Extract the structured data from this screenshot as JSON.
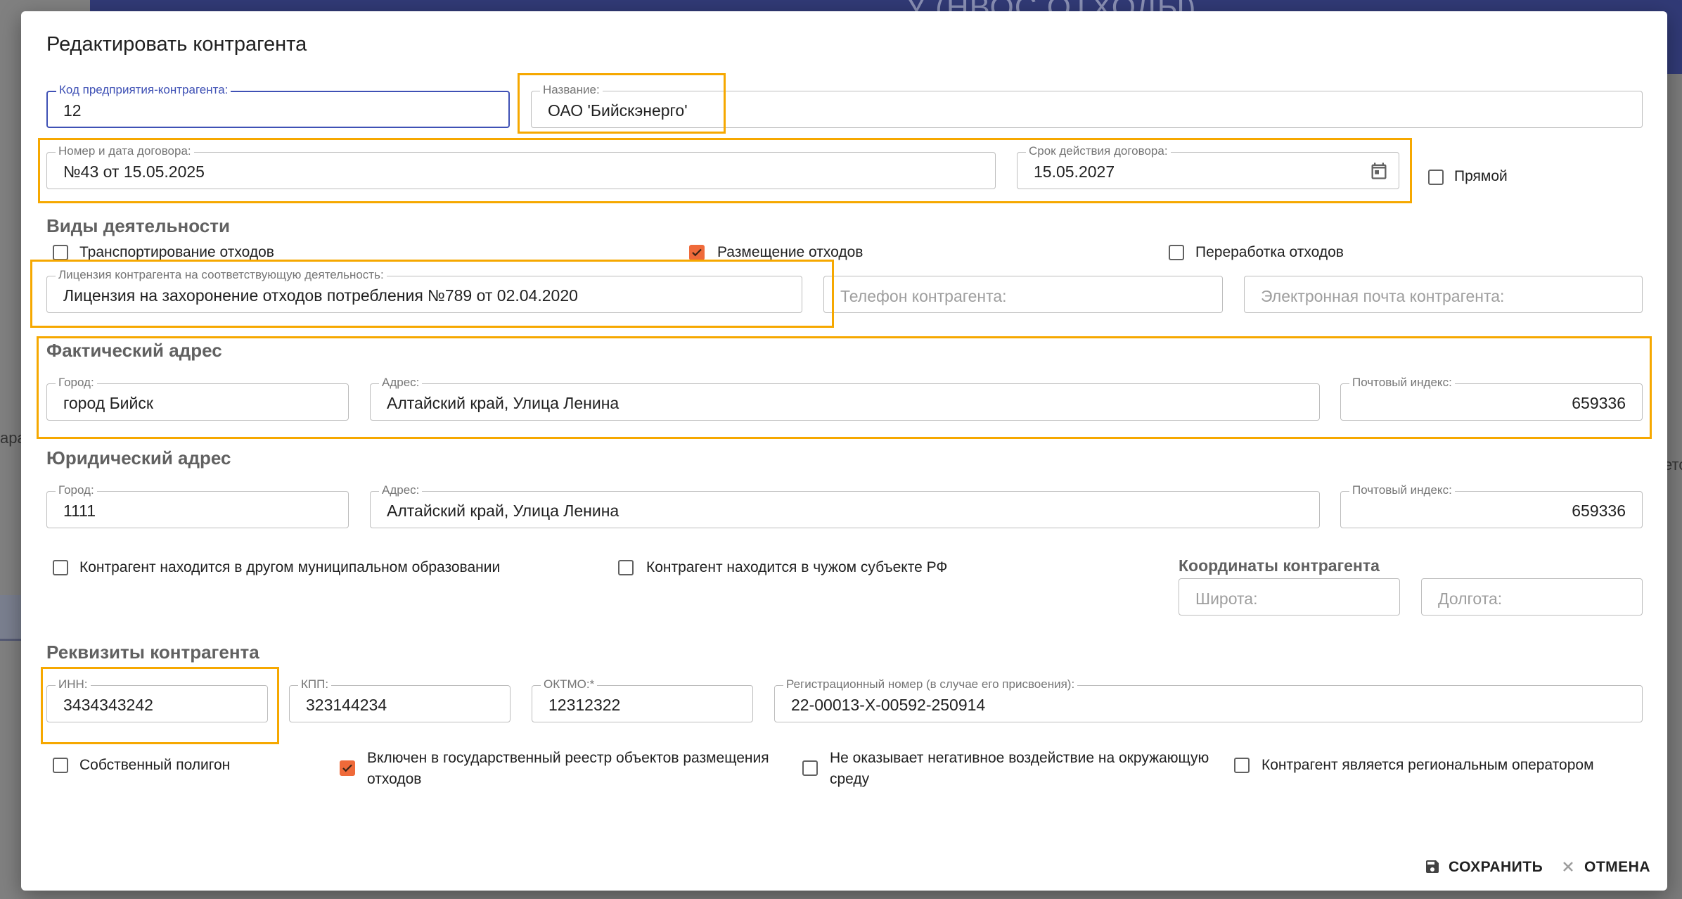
{
  "background": {
    "header_text": "У (НВОС ОТХОДЫ)",
    "sidebar_text": "ара",
    "right_text": "ето"
  },
  "dialog": {
    "title": "Редактировать контрагента",
    "fields": {
      "code": {
        "label": "Код предприятия-контрагента:",
        "value": "12"
      },
      "name": {
        "label": "Название:",
        "value": "ОАО 'Бийскэнерго'"
      },
      "contract": {
        "label": "Номер и дата договора:",
        "value": "№43 от 15.05.2025"
      },
      "contract_term": {
        "label": "Срок действия договора:",
        "value": "15.05.2027",
        "icon": "calendar-icon"
      },
      "license": {
        "label": "Лицензия контрагента на соответствующую деятельность:",
        "value": "Лицензия на захоронение отходов потребления №789 от 02.04.2020"
      },
      "phone": {
        "placeholder": "Телефон контрагента:"
      },
      "email": {
        "placeholder": "Электронная почта контрагента:"
      }
    },
    "direct": {
      "label": "Прямой",
      "checked": false
    },
    "activities": {
      "title": "Виды деятельности",
      "items": [
        {
          "label": "Транспортирование отходов",
          "checked": false
        },
        {
          "label": "Размещение отходов",
          "checked": true
        },
        {
          "label": "Переработка отходов",
          "checked": false
        }
      ]
    },
    "actual_address": {
      "title": "Фактический адрес",
      "city": {
        "label": "Город:",
        "value": "город Бийск"
      },
      "address": {
        "label": "Адрес:",
        "value": "Алтайский край, Улица Ленина"
      },
      "postcode": {
        "label": "Почтовый индекс:",
        "value": "659336"
      }
    },
    "legal_address": {
      "title": "Юридический адрес",
      "city": {
        "label": "Город:",
        "value": "1111"
      },
      "address": {
        "label": "Адрес:",
        "value": "Алтайский край, Улица Ленина"
      },
      "postcode": {
        "label": "Почтовый индекс:",
        "value": "659336"
      }
    },
    "location_flags": [
      {
        "label": "Контрагент находится в другом муниципальном образовании",
        "checked": false
      },
      {
        "label": "Контрагент находится в чужом субъекте РФ",
        "checked": false
      }
    ],
    "coordinates": {
      "title": "Координаты контрагента",
      "lat_placeholder": "Широта:",
      "lon_placeholder": "Долгота:"
    },
    "requisites": {
      "title": "Реквизиты контрагента",
      "inn": {
        "label": "ИНН:",
        "value": "3434343242"
      },
      "kpp": {
        "label": "КПП:",
        "value": "323144234"
      },
      "oktmo": {
        "label": "ОКТМО:*",
        "value": "12312322"
      },
      "reg_number": {
        "label": "Регистрационный номер (в случае его присвоения):",
        "value": "22-00013-Х-00592-250914"
      }
    },
    "bottom_flags": [
      {
        "label": "Собственный полигон",
        "checked": false
      },
      {
        "label_line1": "Включен в государственный реестр объектов размещения",
        "label_line2": "отходов",
        "checked": true
      },
      {
        "label_line1": "Не оказывает негативное воздействие на окружающую",
        "label_line2": "среду",
        "checked": false
      },
      {
        "label": "Контрагент является региональным оператором",
        "checked": false
      }
    ],
    "actions": {
      "save": "СОХРАНИТЬ",
      "save_icon": "floppy-disk-icon",
      "cancel": "ОТМЕНА",
      "cancel_icon": "close-icon"
    }
  },
  "colors": {
    "accent": "#3f51b5",
    "checkbox_checked": "#ef6a3a",
    "highlight": "#f6a800",
    "header": "#313a76"
  }
}
